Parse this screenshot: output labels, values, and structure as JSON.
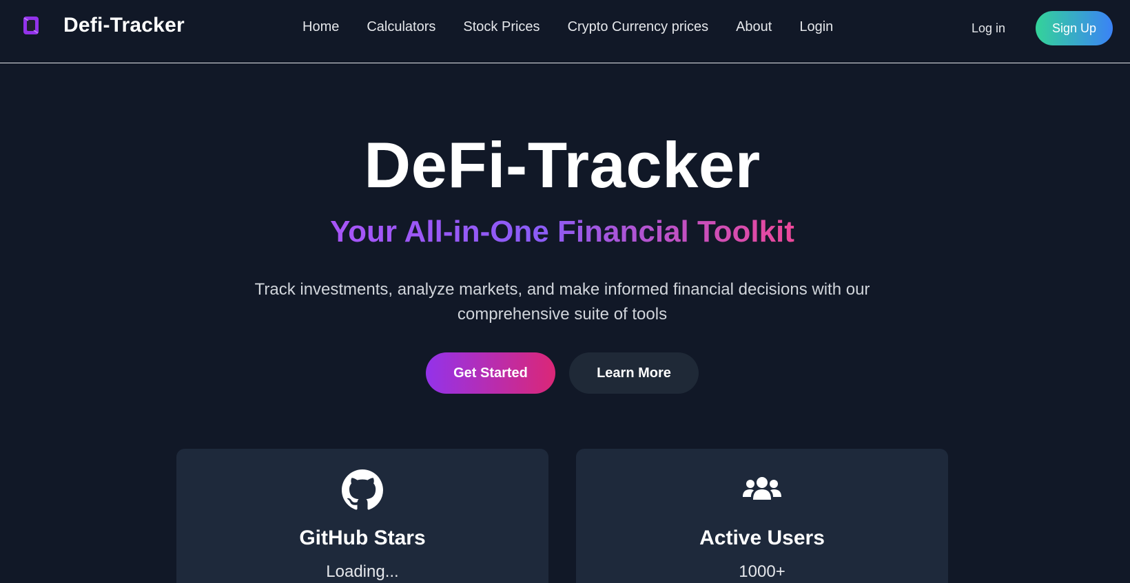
{
  "brand": {
    "name": "Defi-Tracker",
    "logo_icon": "phone-logo-icon",
    "logo_color": "#9333ea"
  },
  "nav": {
    "links": [
      "Home",
      "Calculators",
      "Stock Prices",
      "Crypto Currency prices",
      "About",
      "Login"
    ],
    "login_label": "Log in",
    "signup_label": "Sign Up"
  },
  "hero": {
    "title": "DeFi-Tracker",
    "subtitle": "Your All-in-One Financial Toolkit",
    "description": "Track investments, analyze markets, and make informed financial decisions with our comprehensive suite of tools",
    "primary_button": "Get Started",
    "secondary_button": "Learn More"
  },
  "stats": [
    {
      "icon": "github-icon",
      "title": "GitHub Stars",
      "value": "Loading..."
    },
    {
      "icon": "users-icon",
      "title": "Active Users",
      "value": "1000+"
    }
  ],
  "colors": {
    "background": "#111827",
    "card": "#1e293b",
    "accent_gradient_start": "#9333ea",
    "accent_gradient_end": "#db2777",
    "signup_gradient_start": "#34d399",
    "signup_gradient_end": "#3b82f6"
  }
}
